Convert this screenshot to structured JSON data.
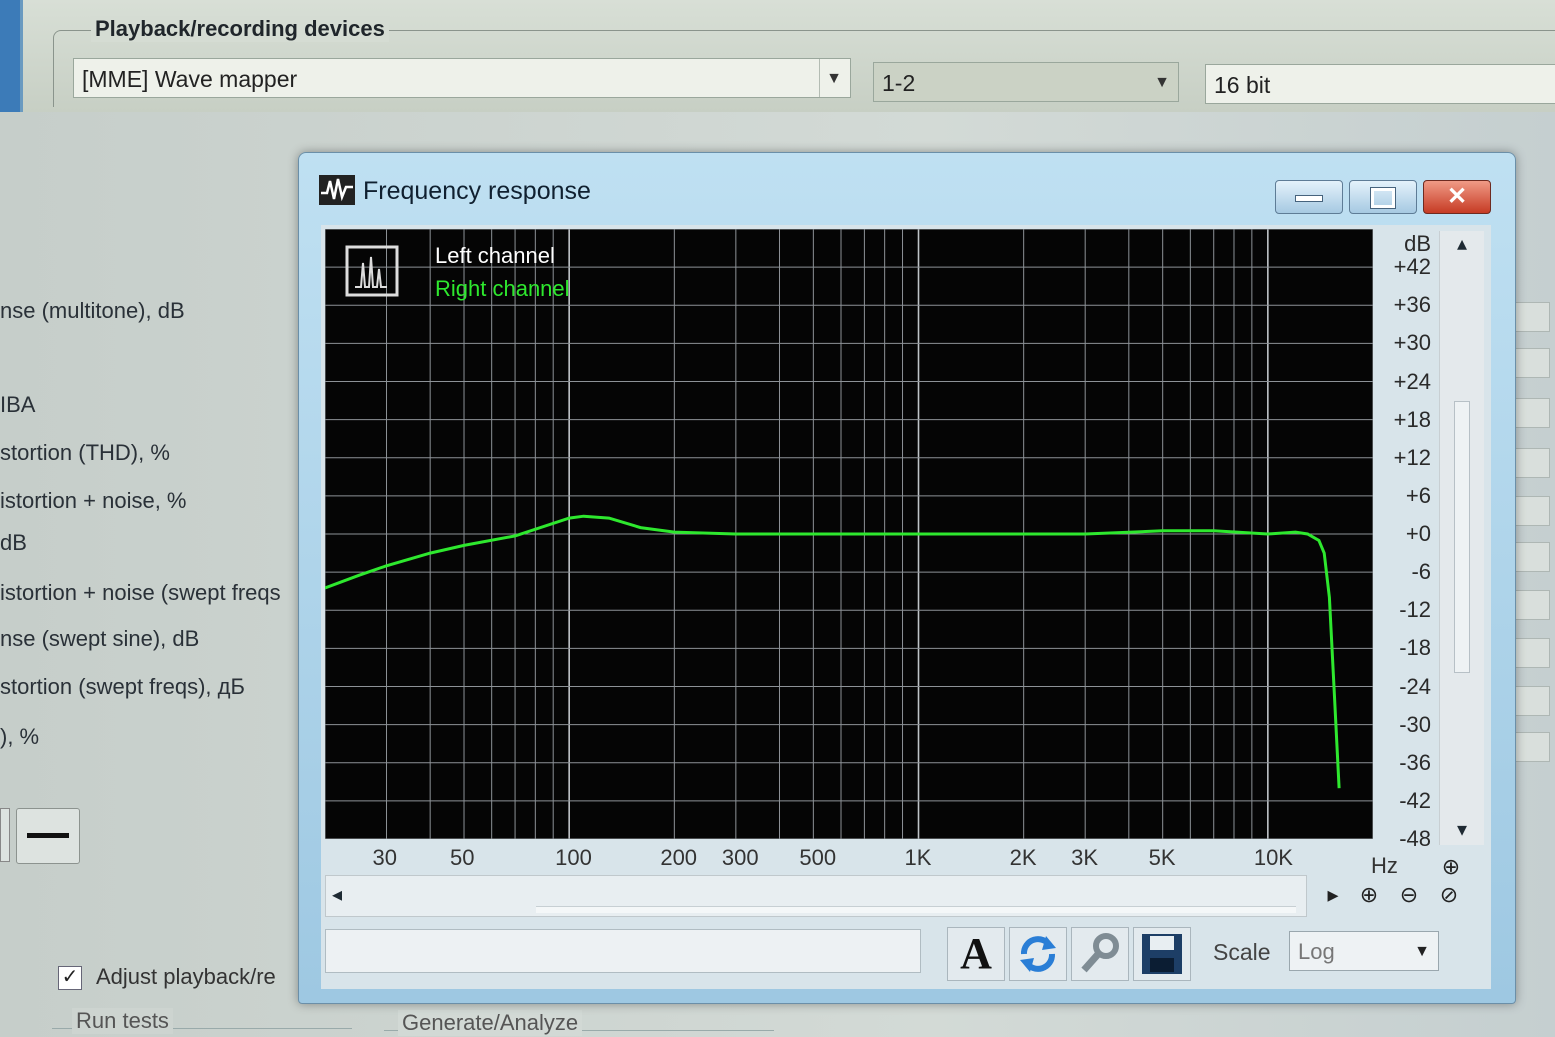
{
  "top": {
    "group_label": "Playback/recording devices",
    "device_combo": "[MME] Wave mapper",
    "channels_combo": "1-2",
    "bits_combo": "16 bit"
  },
  "tests": [
    "nse (multitone), dB",
    "IBA",
    "stortion (THD), %",
    "istortion + noise, %",
    "dB",
    "istortion + noise (swept freqs",
    "nse (swept sine), dB",
    "stortion (swept freqs), дБ",
    "), %"
  ],
  "bottom": {
    "adjust_label": "Adjust playback/re",
    "adjust_checked": "✓",
    "run_tests_label": "Run tests",
    "generate_label": "Generate/Analyze"
  },
  "window": {
    "title": "Frequency response",
    "minimize": "—",
    "maximize": "□",
    "close": "✕"
  },
  "legend": {
    "left": "Left channel",
    "right": "Right channel",
    "left_color": "#ffffff",
    "right_color": "#2ee82e"
  },
  "toolbar": {
    "text_tool": "A",
    "scale_label": "Scale",
    "scale_value": "Log",
    "hz_label": "Hz",
    "db_label": "dB",
    "scroll_left": "◂",
    "scroll_right": "▸",
    "scroll_up": "▴",
    "scroll_down": "▾",
    "zoom_in": "⊕",
    "zoom_out": "⊖",
    "zoom_fit": "⊘"
  },
  "chart_data": {
    "type": "line",
    "title": "Frequency response",
    "xlabel": "Hz",
    "ylabel": "dB",
    "x_scale": "log",
    "grid": true,
    "legend_position": "top-left",
    "xlim": [
      20,
      20000
    ],
    "ylim": [
      -48,
      48
    ],
    "x_ticks": [
      {
        "value": 30,
        "label": "30"
      },
      {
        "value": 50,
        "label": "50"
      },
      {
        "value": 100,
        "label": "100"
      },
      {
        "value": 200,
        "label": "200"
      },
      {
        "value": 300,
        "label": "300"
      },
      {
        "value": 500,
        "label": "500"
      },
      {
        "value": 1000,
        "label": "1K"
      },
      {
        "value": 2000,
        "label": "2K"
      },
      {
        "value": 3000,
        "label": "3K"
      },
      {
        "value": 5000,
        "label": "5K"
      },
      {
        "value": 10000,
        "label": "10K"
      }
    ],
    "y_ticks": [
      {
        "value": 42,
        "label": "+42"
      },
      {
        "value": 36,
        "label": "+36"
      },
      {
        "value": 30,
        "label": "+30"
      },
      {
        "value": 24,
        "label": "+24"
      },
      {
        "value": 18,
        "label": "+18"
      },
      {
        "value": 12,
        "label": "+12"
      },
      {
        "value": 6,
        "label": "+6"
      },
      {
        "value": 0,
        "label": "+0"
      },
      {
        "value": -6,
        "label": "-6"
      },
      {
        "value": -12,
        "label": "-12"
      },
      {
        "value": -18,
        "label": "-18"
      },
      {
        "value": -24,
        "label": "-24"
      },
      {
        "value": -30,
        "label": "-30"
      },
      {
        "value": -36,
        "label": "-36"
      },
      {
        "value": -42,
        "label": "-42"
      },
      {
        "value": -48,
        "label": "-48"
      }
    ],
    "series": [
      {
        "name": "Right channel",
        "x": [
          20,
          25,
          30,
          40,
          50,
          70,
          100,
          110,
          130,
          160,
          200,
          300,
          500,
          1000,
          2000,
          3000,
          5000,
          7000,
          10000,
          12000,
          13000,
          14000,
          14500,
          15000,
          15500,
          16000
        ],
        "values": [
          -8.5,
          -6.5,
          -5,
          -3,
          -1.8,
          -0.3,
          2.5,
          2.8,
          2.5,
          1.0,
          0.3,
          0,
          0,
          0,
          0,
          0,
          0.5,
          0.5,
          0,
          0.3,
          0,
          -1,
          -3,
          -10,
          -25,
          -40
        ]
      }
    ]
  }
}
